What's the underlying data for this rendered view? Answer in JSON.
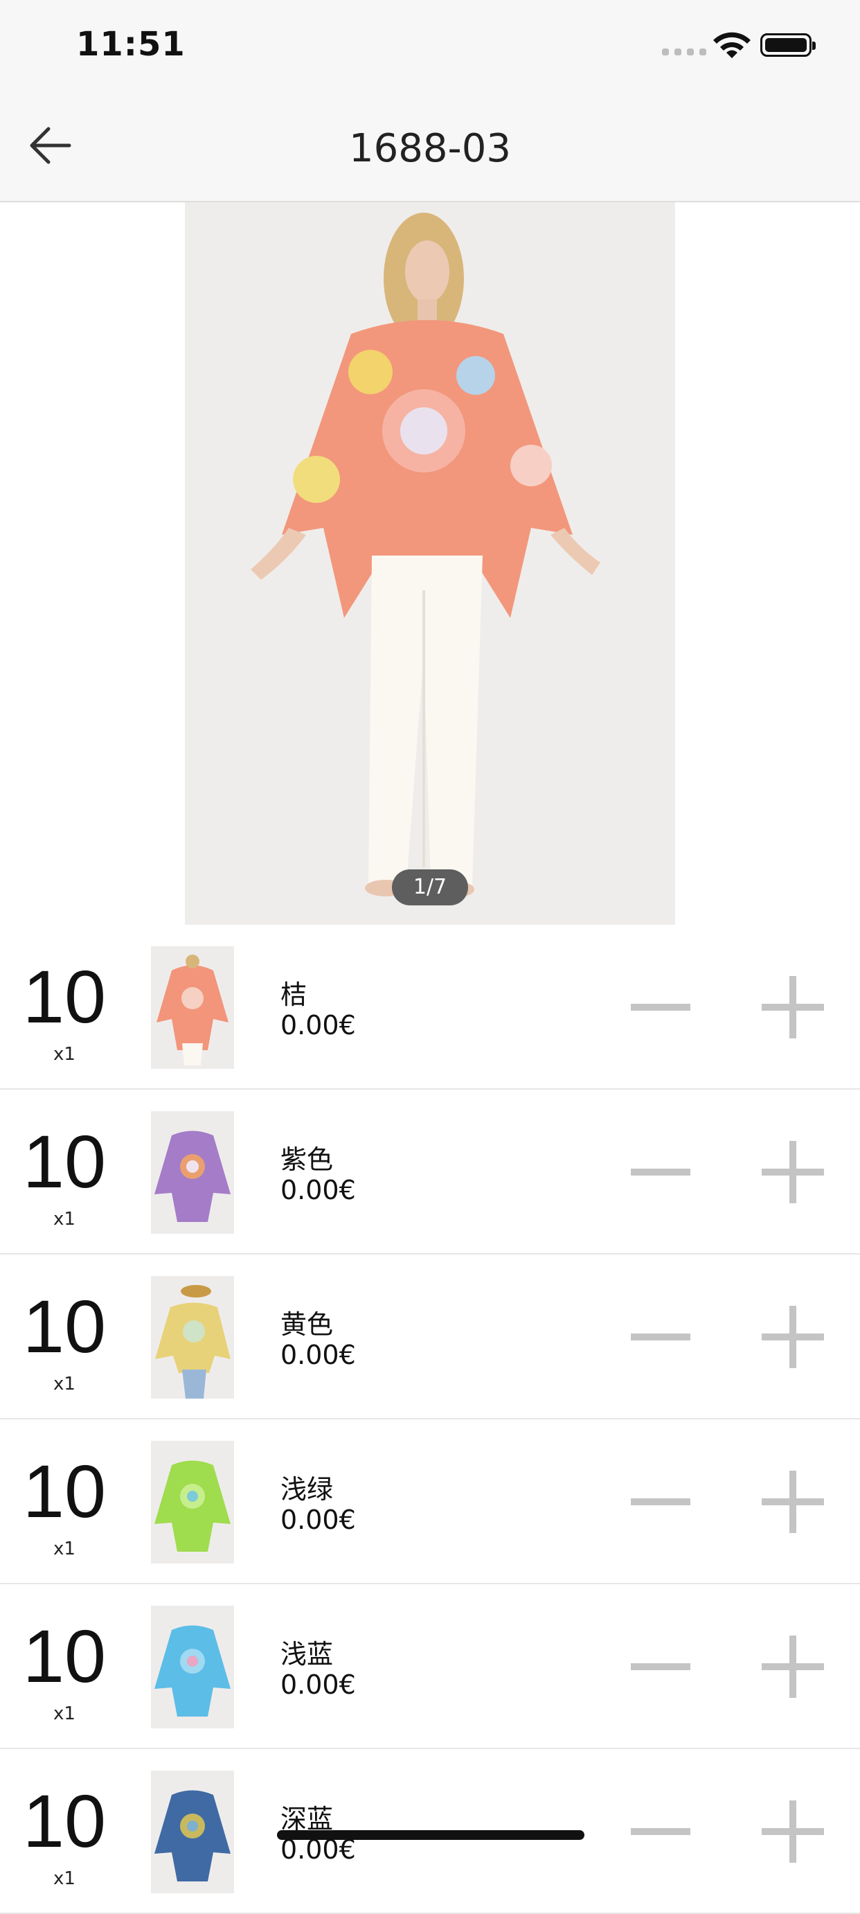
{
  "status_bar": {
    "time": "11:51"
  },
  "nav": {
    "back_icon": "arrow-left-icon",
    "title": "1688-03"
  },
  "gallery": {
    "pager": "1/7"
  },
  "variants": [
    {
      "qty": "10",
      "multiplier": "x1",
      "name": "桔",
      "price": "0.00€",
      "color": "#f2957a"
    },
    {
      "qty": "10",
      "multiplier": "x1",
      "name": "紫色",
      "price": "0.00€",
      "color": "#a47cc8"
    },
    {
      "qty": "10",
      "multiplier": "x1",
      "name": "黄色",
      "price": "0.00€",
      "color": "#e8d279"
    },
    {
      "qty": "10",
      "multiplier": "x1",
      "name": "浅绿",
      "price": "0.00€",
      "color": "#9fdc4e"
    },
    {
      "qty": "10",
      "multiplier": "x1",
      "name": "浅蓝",
      "price": "0.00€",
      "color": "#5cbde6"
    },
    {
      "qty": "10",
      "multiplier": "x1",
      "name": "深蓝",
      "price": "0.00€",
      "color": "#3f6aa4"
    }
  ]
}
